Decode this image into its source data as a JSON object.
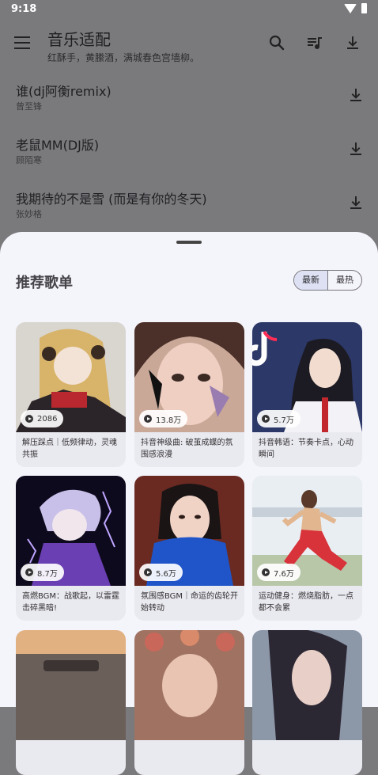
{
  "status": {
    "time": "9:18"
  },
  "appbar": {
    "title": "音乐适配",
    "subtitle": "红酥手，黄縢酒，满城春色宫墙柳。",
    "icons": [
      "menu-icon",
      "search-icon",
      "playlist-icon",
      "download-icon"
    ]
  },
  "songs": [
    {
      "title": "谁(dj阿衡remix)",
      "artist": "曾至锋"
    },
    {
      "title": "老鼠MM(DJ版)",
      "artist": "顾陌寒"
    },
    {
      "title": "我期待的不是雪 (而是有你的冬天)",
      "artist": "张妙格"
    }
  ],
  "sheet": {
    "title": "推荐歌单",
    "sort_options": [
      "最新",
      "最热"
    ],
    "selected": "最新"
  },
  "playlists": [
    {
      "count": "2086",
      "name": "解压踩点｜低频律动，灵魂共振"
    },
    {
      "count": "13.8万",
      "name": "抖音神级曲: 破茧成蝶的氛围感浪漫"
    },
    {
      "count": "5.7万",
      "name": "抖音韩语：节奏卡点，心动瞬间"
    },
    {
      "count": "8.7万",
      "name": "高燃BGM：战歌起，以雷霆击碎黑暗!"
    },
    {
      "count": "5.6万",
      "name": "氛围感BGM｜命运的齿轮开始转动"
    },
    {
      "count": "7.6万",
      "name": "运动健身：燃烧脂肪，一点都不会累"
    }
  ]
}
